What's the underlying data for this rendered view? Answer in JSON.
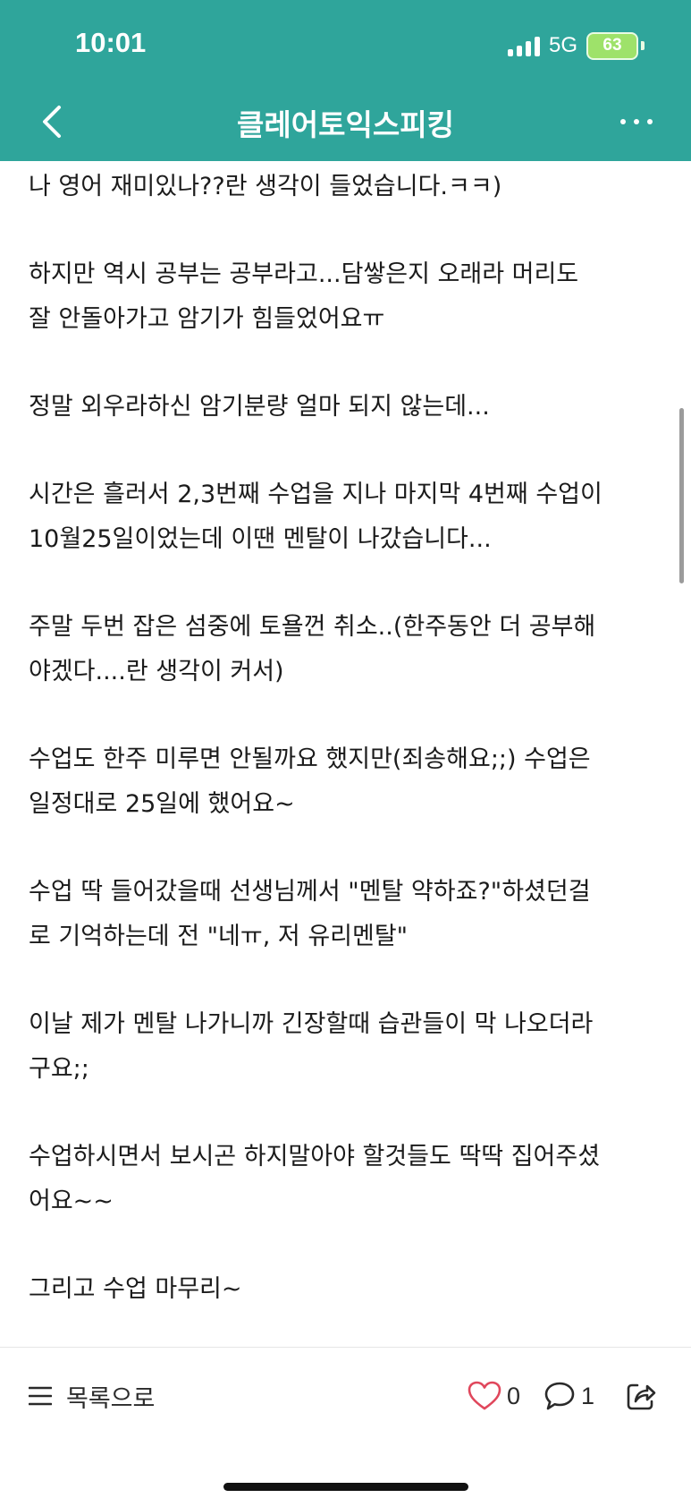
{
  "status_bar": {
    "time": "10:01",
    "network": "5G",
    "battery": "63"
  },
  "header": {
    "title": "클레어토익스피킹"
  },
  "post": {
    "paragraphs": [
      [
        "나 영어 재미있나??란 생각이 들었습니다.ㅋㅋ)"
      ],
      [
        "하지만 역시 공부는 공부라고...담쌓은지 오래라 머리도",
        "잘 안돌아가고 암기가 힘들었어요ㅠ"
      ],
      [
        "정말 외우라하신 암기분량 얼마 되지 않는데..."
      ],
      [
        "시간은 흘러서 2,3번째 수업을 지나 마지막 4번째 수업이",
        "10월25일이었는데 이땐 멘탈이 나갔습니다..."
      ],
      [
        "주말 두번 잡은 섬중에 토욜껀 취소..(한주동안 더 공부해",
        "야겠다....란 생각이 커서)"
      ],
      [
        "수업도 한주 미루면 안될까요 했지만(죄송해요;;) 수업은",
        "일정대로 25일에 했어요~"
      ],
      [
        "수업 딱 들어갔을때 선생님께서 \"멘탈 약하죠?\"하셨던걸",
        "로 기억하는데 전 \"네ㅠ, 저 유리멘탈\""
      ],
      [
        "이날 제가 멘탈 나가니까 긴장할때 습관들이 막 나오더라",
        "구요;;"
      ],
      [
        "수업하시면서 보시곤 하지말아야 할것들도 딱딱 집어주셨",
        "어요~~"
      ],
      [
        "그리고 수업 마무리~"
      ]
    ]
  },
  "bottom_bar": {
    "list_label": "목록으로",
    "like_count": "0",
    "comment_count": "1"
  },
  "colors": {
    "header_bg": "#2fa59b",
    "heart": "#e0475c"
  }
}
